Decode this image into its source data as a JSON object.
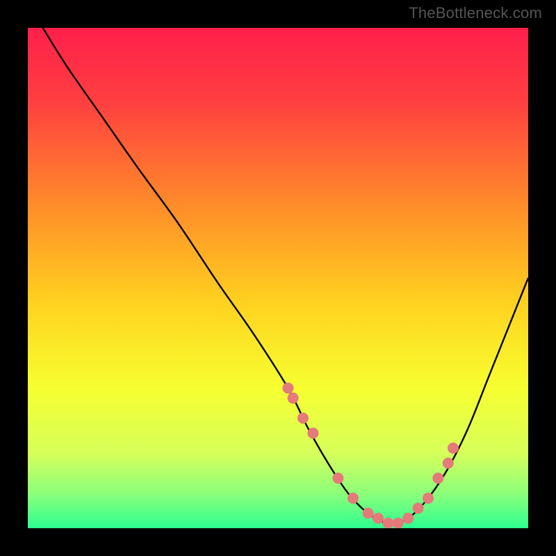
{
  "watermark": "TheBottleneck.com",
  "chart_data": {
    "type": "line",
    "title": "",
    "xlabel": "",
    "ylabel": "",
    "xlim": [
      0,
      100
    ],
    "ylim": [
      0,
      100
    ],
    "curve": {
      "name": "bottleneck_curve",
      "x": [
        3,
        8,
        15,
        22,
        30,
        38,
        45,
        52,
        56,
        60,
        64,
        68,
        72,
        76,
        80,
        84,
        88,
        92,
        96,
        100
      ],
      "y": [
        100,
        92,
        82,
        72,
        61,
        49,
        39,
        28,
        20,
        13,
        7,
        3,
        1,
        2,
        6,
        12,
        20,
        30,
        40,
        50
      ]
    },
    "markers": {
      "name": "bottleneck_points",
      "x": [
        52,
        53,
        55,
        57,
        62,
        65,
        68,
        70,
        72,
        74,
        76,
        78,
        80,
        82,
        84,
        85
      ],
      "y": [
        28,
        26,
        22,
        19,
        10,
        6,
        3,
        2,
        1,
        1,
        2,
        4,
        6,
        10,
        13,
        16
      ],
      "color": "#e47a7a",
      "radius": 8
    },
    "gradient_stops": [
      {
        "offset": 0.0,
        "color": "#ff1f4b"
      },
      {
        "offset": 0.15,
        "color": "#ff4040"
      },
      {
        "offset": 0.35,
        "color": "#ff8a2a"
      },
      {
        "offset": 0.55,
        "color": "#ffd21f"
      },
      {
        "offset": 0.72,
        "color": "#f6ff30"
      },
      {
        "offset": 0.85,
        "color": "#d6ff5a"
      },
      {
        "offset": 0.93,
        "color": "#8dff7a"
      },
      {
        "offset": 1.0,
        "color": "#2dff8f"
      }
    ]
  }
}
